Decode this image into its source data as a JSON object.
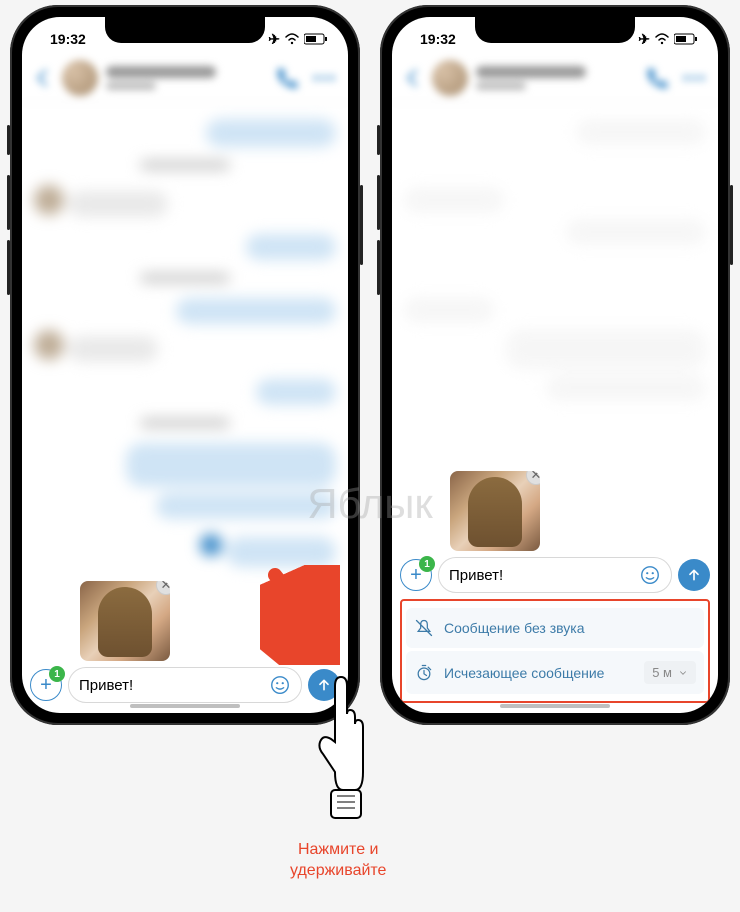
{
  "status": {
    "time": "19:32",
    "airplane": "✈",
    "wifi": "wifi",
    "battery": "battery"
  },
  "composer": {
    "badge": "1",
    "text": "Привет!",
    "plus": "+"
  },
  "options": {
    "silent": "Сообщение без звука",
    "disappearing": "Исчезающее сообщение",
    "timer": "5 м"
  },
  "instruction": {
    "line1": "Нажмите и",
    "line2": "удерживайте"
  },
  "watermark": "Яблык"
}
